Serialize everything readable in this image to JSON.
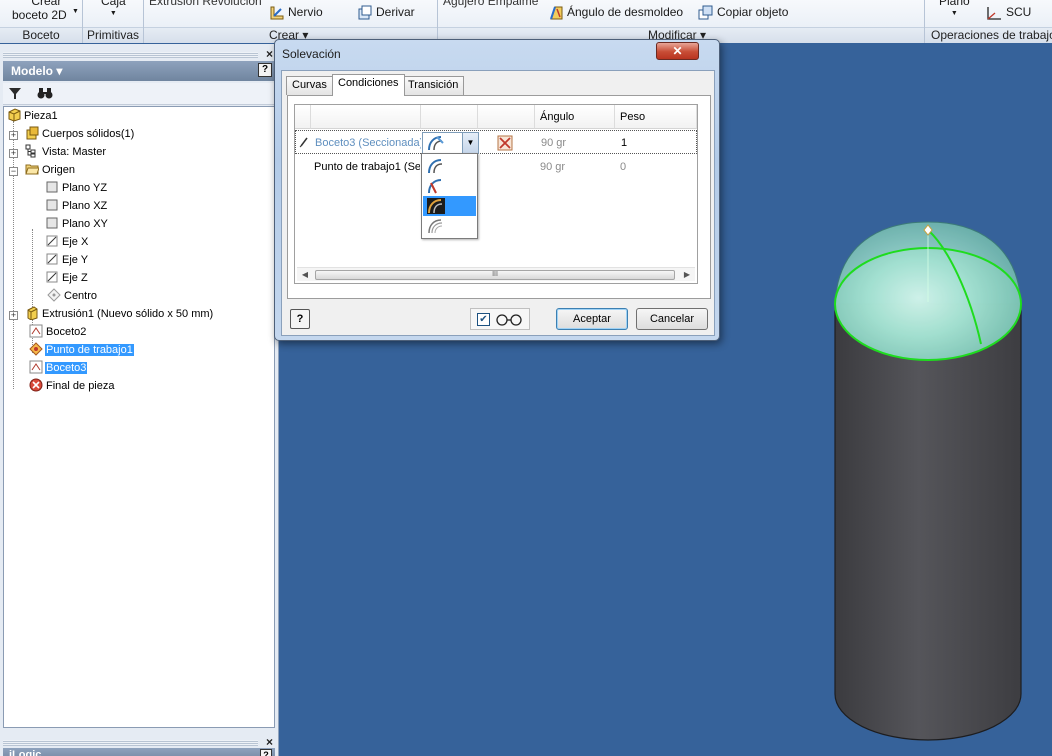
{
  "ribbon": {
    "crear_boceto": [
      "Crear",
      "boceto 2D"
    ],
    "caja": "Caja",
    "extrusion_revolucion": "Extrusión  Revolución",
    "nervio": "Nervio",
    "derivar": "Derivar",
    "agujero_empalme": "Agujero  Empalme",
    "angulo_desmoldeo": "Ángulo de desmoldeo",
    "copiar_objeto": "Copiar objeto",
    "plano": "Plano",
    "scu": "SCU",
    "panels": {
      "boceto": "Boceto",
      "primitivas": "Primitivas",
      "crear": "Crear ▾",
      "modificar": "Modificar ▾",
      "operaciones": "Operaciones de trabajo"
    }
  },
  "browser": {
    "title": "Modelo ▾",
    "help": "?",
    "close": "×",
    "tree": [
      {
        "label": "Pieza1",
        "icon": "part-icon"
      },
      {
        "label": "Cuerpos sólidos(1)",
        "icon": "solid-bodies-icon"
      },
      {
        "label": "Vista: Master",
        "icon": "view-icon"
      },
      {
        "label": "Origen",
        "icon": "folder-icon"
      },
      {
        "label": "Plano YZ",
        "icon": "plane-icon"
      },
      {
        "label": "Plano XZ",
        "icon": "plane-icon"
      },
      {
        "label": "Plano XY",
        "icon": "plane-icon"
      },
      {
        "label": "Eje X",
        "icon": "axis-icon"
      },
      {
        "label": "Eje Y",
        "icon": "axis-icon"
      },
      {
        "label": "Eje Z",
        "icon": "axis-icon"
      },
      {
        "label": "Centro",
        "icon": "center-point-icon"
      },
      {
        "label": "Extrusión1 (Nuevo sólido x 50 mm)",
        "icon": "extrusion-icon"
      },
      {
        "label": "Boceto2",
        "icon": "sketch-icon"
      },
      {
        "label": "Punto de trabajo1",
        "icon": "work-point-icon"
      },
      {
        "label": "Boceto3",
        "icon": "sketch-icon"
      },
      {
        "label": "Final de pieza",
        "icon": "end-of-part-icon"
      }
    ],
    "bottom_title": "iLogic"
  },
  "dialog": {
    "title": "Solevación",
    "close": "✕",
    "tabs": [
      "Curvas",
      "Condiciones",
      "Transición"
    ],
    "active_tab": "Condiciones",
    "columns": {
      "angle": "Ángulo",
      "weight": "Peso"
    },
    "rows": [
      {
        "name": "Boceto3 (Seccionada)",
        "angle": "90 gr",
        "weight": "1"
      },
      {
        "name": "Punto de trabajo1 (Se",
        "angle": "90 gr",
        "weight": "0"
      }
    ],
    "scroll_grip": "III",
    "help": "?",
    "buttons": {
      "ok": "Aceptar",
      "cancel": "Cancelar"
    },
    "preview_checked": true
  },
  "colors": {
    "viewport": "#36629a",
    "selection": "#3399ff",
    "cylinder": "#47474b",
    "highlight_green": "#1edc1e",
    "dome": "#8fd9c7"
  }
}
